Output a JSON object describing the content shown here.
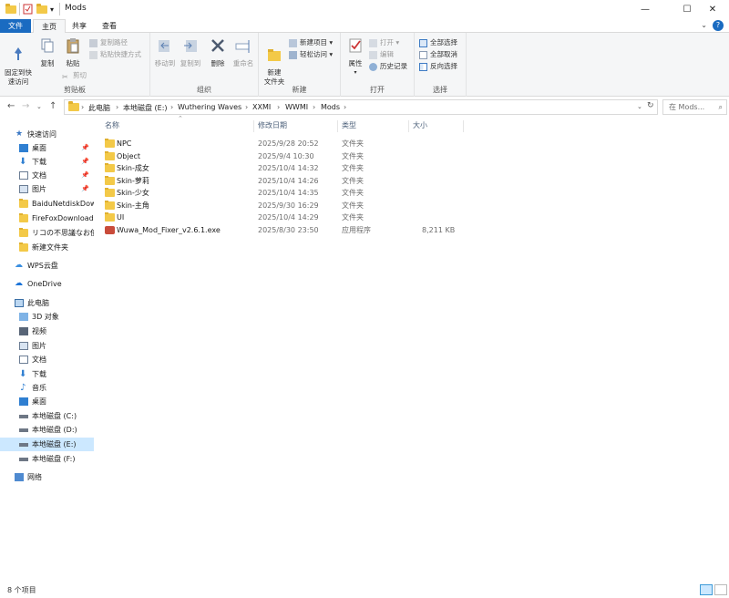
{
  "window": {
    "title": "Mods",
    "controls": {
      "minimize": "—",
      "maximize": "☐",
      "close": "✕"
    },
    "quick_access_dropdown": "▾"
  },
  "ribbon": {
    "tabs": [
      "文件",
      "主页",
      "共享",
      "查看"
    ],
    "active_tab": "主页",
    "clipboard": {
      "label": "剪贴板",
      "pin_quick": "固定到快\n速访问",
      "copy": "复制",
      "paste": "粘贴",
      "copy_path": "复制路径",
      "paste_shortcut": "粘贴快捷方式",
      "cut": "剪切"
    },
    "organize": {
      "label": "组织",
      "move_to": "移动到",
      "copy_to": "复制到",
      "delete": "删除",
      "rename": "重命名"
    },
    "new": {
      "label": "新建",
      "new_folder": "新建\n文件夹",
      "new_item": "新建项目",
      "easy_access": "轻松访问"
    },
    "open": {
      "label": "打开",
      "properties": "属性",
      "open": "打开",
      "edit": "编辑",
      "history": "历史记录"
    },
    "select": {
      "label": "选择",
      "select_all": "全部选择",
      "select_none": "全部取消",
      "invert": "反向选择"
    }
  },
  "address_bar": {
    "breadcrumbs": [
      "此电脑",
      "本地磁盘 (E:)",
      "Wuthering Waves",
      "XXMI",
      "WWMI",
      "Mods"
    ],
    "search_placeholder": "在 Mods..."
  },
  "nav_pane": {
    "quick_access": "快速访问",
    "quick_items": [
      {
        "label": "桌面",
        "pinned": true
      },
      {
        "label": "下载",
        "pinned": true
      },
      {
        "label": "文档",
        "pinned": true
      },
      {
        "label": "图片",
        "pinned": true
      },
      {
        "label": "BaiduNetdiskDow",
        "pinned": false
      },
      {
        "label": "FireFoxDownload",
        "pinned": false
      },
      {
        "label": "リコの不思議なお使",
        "pinned": false
      },
      {
        "label": "新建文件夹",
        "pinned": false
      }
    ],
    "wps": "WPS云盘",
    "onedrive": "OneDrive",
    "this_pc": "此电脑",
    "pc_items": [
      "3D 对象",
      "视频",
      "图片",
      "文档",
      "下载",
      "音乐",
      "桌面",
      "本地磁盘 (C:)",
      "本地磁盘 (D:)",
      "本地磁盘 (E:)",
      "本地磁盘 (F:)"
    ],
    "selected": "本地磁盘 (E:)",
    "network": "网络",
    "pin_glyph": "📌"
  },
  "file_list": {
    "columns": {
      "name": "名称",
      "date": "修改日期",
      "type": "类型",
      "size": "大小"
    },
    "rows": [
      {
        "name": "NPC",
        "date": "2025/9/28 20:52",
        "type": "文件夹",
        "size": "",
        "kind": "folder"
      },
      {
        "name": "Object",
        "date": "2025/9/4 10:30",
        "type": "文件夹",
        "size": "",
        "kind": "folder"
      },
      {
        "name": "Skin-成女",
        "date": "2025/10/4 14:32",
        "type": "文件夹",
        "size": "",
        "kind": "folder"
      },
      {
        "name": "Skin-萝莉",
        "date": "2025/10/4 14:26",
        "type": "文件夹",
        "size": "",
        "kind": "folder"
      },
      {
        "name": "Skin-少女",
        "date": "2025/10/4 14:35",
        "type": "文件夹",
        "size": "",
        "kind": "folder"
      },
      {
        "name": "Skin-主角",
        "date": "2025/9/30 16:29",
        "type": "文件夹",
        "size": "",
        "kind": "folder"
      },
      {
        "name": "UI",
        "date": "2025/10/4 14:29",
        "type": "文件夹",
        "size": "",
        "kind": "folder"
      },
      {
        "name": "Wuwa_Mod_Fixer_v2.6.1.exe",
        "date": "2025/8/30 23:50",
        "type": "应用程序",
        "size": "8,211 KB",
        "kind": "exe"
      }
    ]
  },
  "status_bar": {
    "count": "8 个项目"
  },
  "colors": {
    "accent": "#1a6bc1",
    "selected": "#cce8ff",
    "folder": "#f3c948"
  }
}
